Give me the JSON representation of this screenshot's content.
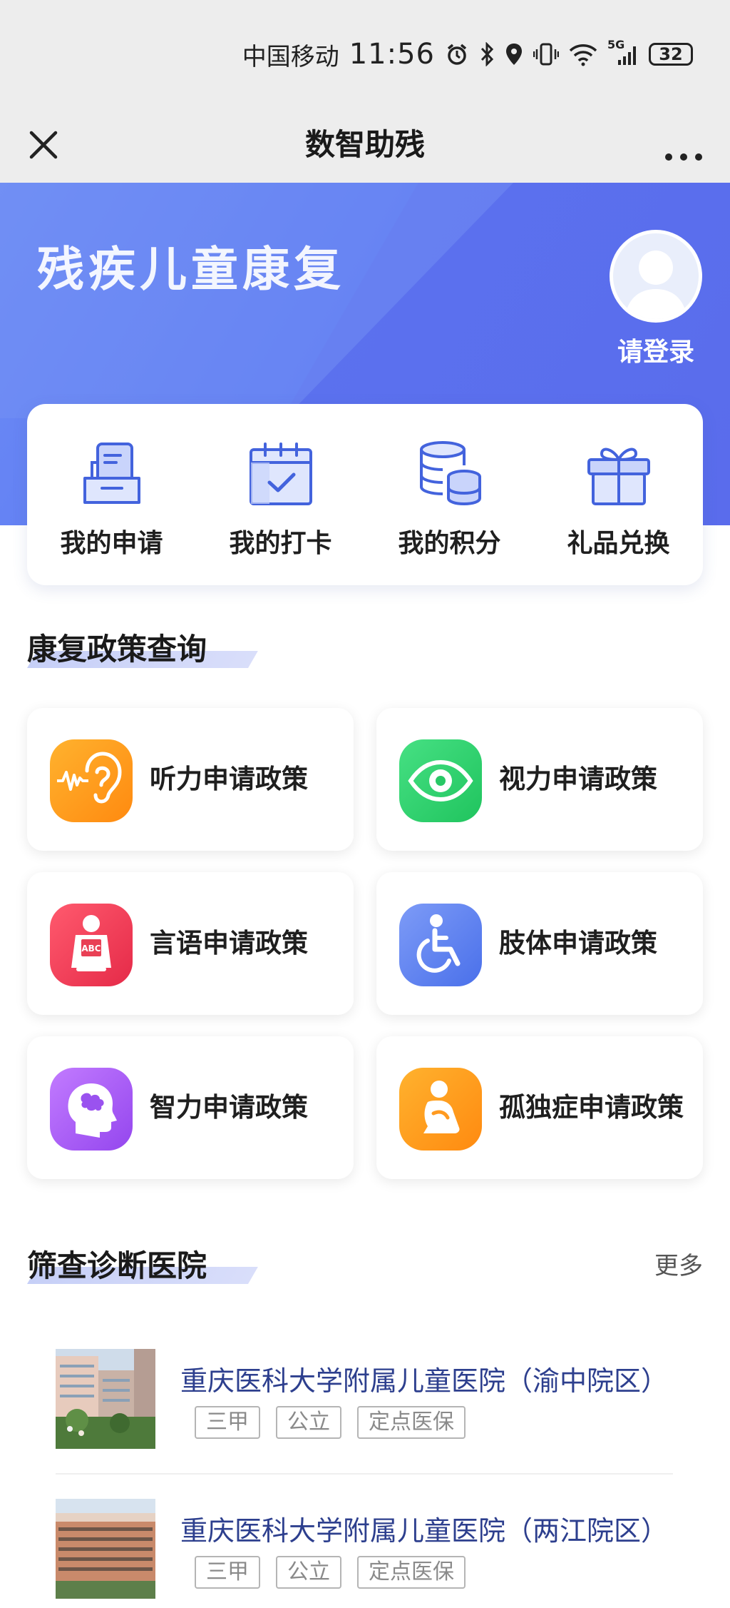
{
  "status_bar": {
    "carrier": "中国移动",
    "time": "11:56",
    "network": "5G",
    "battery": "32"
  },
  "nav": {
    "title": "数智助残"
  },
  "hero": {
    "title": "残疾儿童康复",
    "login_label": "请登录"
  },
  "quick_actions": [
    {
      "label": "我的申请",
      "icon": "application-form-icon"
    },
    {
      "label": "我的打卡",
      "icon": "calendar-check-icon"
    },
    {
      "label": "我的积分",
      "icon": "coins-stack-icon"
    },
    {
      "label": "礼品兑换",
      "icon": "gift-box-icon"
    }
  ],
  "policy_section": {
    "title": "康复政策查询",
    "items": [
      {
        "label": "听力申请政策",
        "icon": "ear-icon",
        "color": "#ff9a1f"
      },
      {
        "label": "视力申请政策",
        "icon": "eye-icon",
        "color": "#2ed36b"
      },
      {
        "label": "言语申请政策",
        "icon": "reading-child-icon",
        "color": "#f0405a"
      },
      {
        "label": "肢体申请政策",
        "icon": "wheelchair-icon",
        "color": "#4f7cf0"
      },
      {
        "label": "智力申请政策",
        "icon": "brain-head-icon",
        "color": "#a35af0"
      },
      {
        "label": "孤独症申请政策",
        "icon": "sitting-child-icon",
        "color": "#ff9a1f"
      }
    ]
  },
  "hospital_section": {
    "title": "筛查诊断医院",
    "more_label": "更多",
    "hospitals": [
      {
        "name": "重庆医科大学附属儿童医院（渝中院区）",
        "tags": [
          "三甲",
          "公立",
          "定点医保"
        ]
      },
      {
        "name": "重庆医科大学附属儿童医院（两江院区）",
        "tags": [
          "三甲",
          "公立",
          "定点医保"
        ]
      }
    ]
  }
}
